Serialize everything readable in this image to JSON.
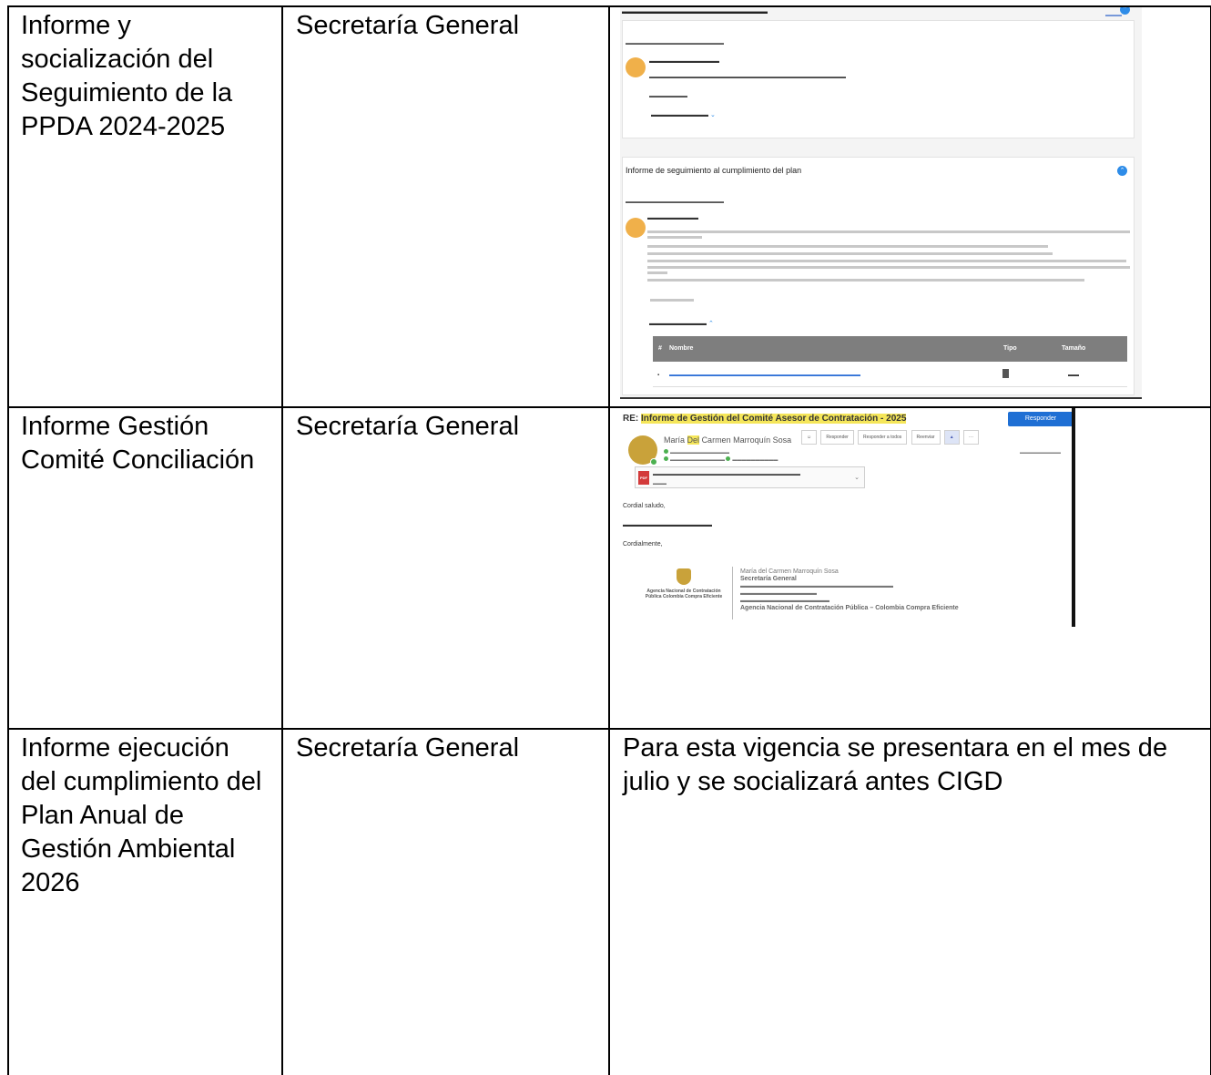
{
  "rows": [
    {
      "report": "Informe y socialización del Seguimiento de la PPDA 2024-2025",
      "responsible": "Secretaría General"
    },
    {
      "report": "Informe Gestión Comité Conciliación",
      "responsible": "Secretaría General"
    },
    {
      "report": "Informe ejecución del cumplimiento del Plan Anual de Gestión Ambiental 2026",
      "responsible": "Secretaría General",
      "evidence": "Para esta vigencia se presentara en el mes de julio y se socializará antes CIGD"
    }
  ],
  "tracking_shot": {
    "card2_title": "Informe de seguimiento al cumplimiento del plan",
    "table": {
      "num": "#",
      "name": "Nombre",
      "type": "Tipo",
      "size": "Tamaño"
    }
  },
  "email_shot": {
    "subject_prefix": "RE:",
    "subject_highlight": "Informe de Gestión del Comité Asesor de Contratación - 2025",
    "reply_label": "Responder",
    "sender_name_a": "María",
    "sender_name_hl": "Del",
    "sender_name_b": "Carmen Marroquín Sosa",
    "actions": [
      "Responder",
      "Responder a todos",
      "Reenviar"
    ],
    "greeting": "Cordial saludo,",
    "closing": "Cordialmente,",
    "signature": {
      "name": "María del Carmen Marroquín Sosa",
      "office": "Secretaría General",
      "agency": "Agencia Nacional de Contratación Pública – Colombia Compra Eficiente"
    },
    "logo_text": "Agencia Nacional de Contratación Pública Colombia Compra Eficiente"
  }
}
